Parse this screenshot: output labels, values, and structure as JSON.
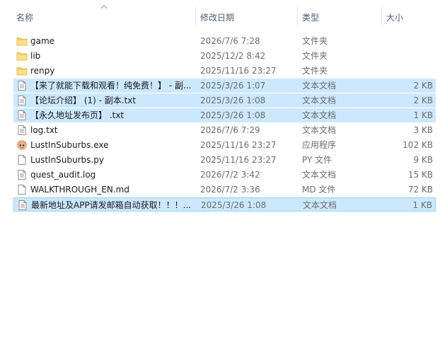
{
  "columns": {
    "name": "名称",
    "date": "修改日期",
    "type": "类型",
    "size": "大小"
  },
  "files": [
    {
      "name": "game",
      "date": "2026/7/6 7:28",
      "type": "文件夹",
      "size": "",
      "icon": "folder-icon",
      "selected": false
    },
    {
      "name": "lib",
      "date": "2025/12/2 8:42",
      "type": "文件夹",
      "size": "",
      "icon": "folder-icon",
      "selected": false
    },
    {
      "name": "renpy",
      "date": "2025/11/16 23:27",
      "type": "文件夹",
      "size": "",
      "icon": "folder-icon",
      "selected": false
    },
    {
      "name": "【来了就能下载和观看！纯免费！】 - 副...",
      "date": "2025/3/26 1:07",
      "type": "文本文档",
      "size": "2 KB",
      "icon": "text-file-icon",
      "selected": true
    },
    {
      "name": "【论坛介绍】 (1) - 副本.txt",
      "date": "2025/3/26 1:08",
      "type": "文本文档",
      "size": "2 KB",
      "icon": "text-file-icon",
      "selected": true
    },
    {
      "name": "【永久地址发布页】 .txt",
      "date": "2025/3/26 1:08",
      "type": "文本文档",
      "size": "1 KB",
      "icon": "text-file-icon",
      "selected": true
    },
    {
      "name": "log.txt",
      "date": "2026/7/6 7:29",
      "type": "文本文档",
      "size": "3 KB",
      "icon": "text-file-icon",
      "selected": false
    },
    {
      "name": "LustInSuburbs.exe",
      "date": "2025/11/16 23:27",
      "type": "应用程序",
      "size": "102 KB",
      "icon": "app-exe-icon",
      "selected": false
    },
    {
      "name": "LustInSuburbs.py",
      "date": "2025/11/16 23:27",
      "type": "PY 文件",
      "size": "9 KB",
      "icon": "blank-file-icon",
      "selected": false
    },
    {
      "name": "quest_audit.log",
      "date": "2026/7/2 3:42",
      "type": "文本文档",
      "size": "15 KB",
      "icon": "text-file-icon",
      "selected": false
    },
    {
      "name": "WALKTHROUGH_EN.md",
      "date": "2026/7/2 3:36",
      "type": "MD 文件",
      "size": "72 KB",
      "icon": "blank-file-icon",
      "selected": false
    },
    {
      "name": "最新地址及APP请发邮箱自动获取！！！...",
      "date": "2025/3/26 1:08",
      "type": "文本文档",
      "size": "1 KB",
      "icon": "text-file-icon",
      "selected": true,
      "focused": true
    }
  ],
  "colors": {
    "selection": "#cce8ff",
    "focus_border": "#99d1ff",
    "header_text": "#4c607a",
    "folder": "#f8d775"
  }
}
